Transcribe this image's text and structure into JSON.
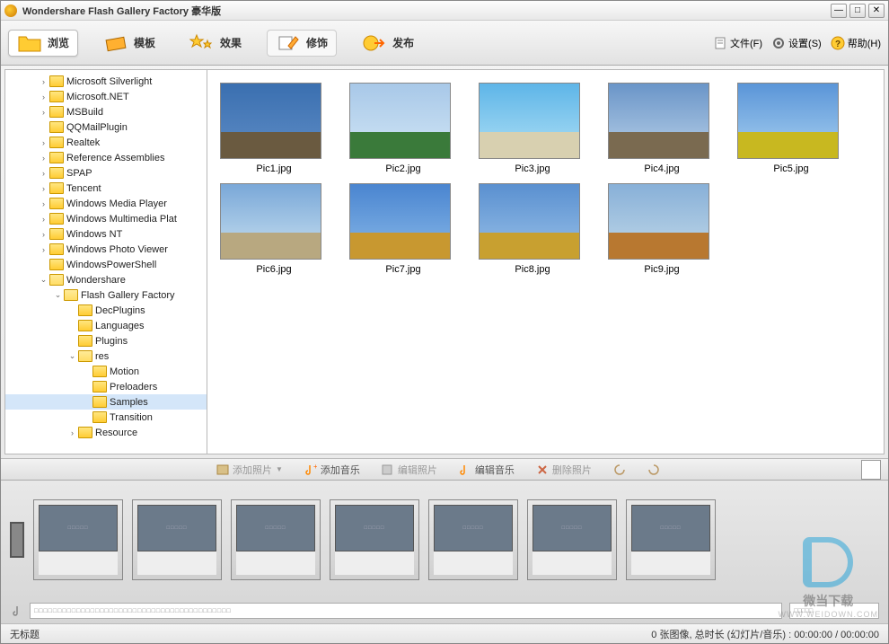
{
  "title": "Wondershare Flash Gallery Factory 豪华版",
  "toolbar": {
    "browse": "浏览",
    "template": "模板",
    "effect": "效果",
    "decorate": "修饰",
    "publish": "发布"
  },
  "menus": {
    "file": "文件(F)",
    "settings": "设置(S)",
    "help": "帮助(H)"
  },
  "tree": [
    {
      "level": 2,
      "arrow": "›",
      "label": "Microsoft Silverlight"
    },
    {
      "level": 2,
      "arrow": "›",
      "label": "Microsoft.NET"
    },
    {
      "level": 2,
      "arrow": "›",
      "label": "MSBuild"
    },
    {
      "level": 2,
      "arrow": "",
      "label": "QQMailPlugin"
    },
    {
      "level": 2,
      "arrow": "›",
      "label": "Realtek"
    },
    {
      "level": 2,
      "arrow": "›",
      "label": "Reference Assemblies"
    },
    {
      "level": 2,
      "arrow": "›",
      "label": "SPAP"
    },
    {
      "level": 2,
      "arrow": "›",
      "label": "Tencent"
    },
    {
      "level": 2,
      "arrow": "›",
      "label": "Windows Media Player"
    },
    {
      "level": 2,
      "arrow": "›",
      "label": "Windows Multimedia Plat"
    },
    {
      "level": 2,
      "arrow": "›",
      "label": "Windows NT"
    },
    {
      "level": 2,
      "arrow": "›",
      "label": "Windows Photo Viewer"
    },
    {
      "level": 2,
      "arrow": "",
      "label": "WindowsPowerShell"
    },
    {
      "level": 2,
      "arrow": "⌄",
      "label": "Wondershare",
      "open": true
    },
    {
      "level": 3,
      "arrow": "⌄",
      "label": "Flash Gallery Factory",
      "open": true
    },
    {
      "level": 4,
      "arrow": "",
      "label": "DecPlugins"
    },
    {
      "level": 4,
      "arrow": "",
      "label": "Languages"
    },
    {
      "level": 4,
      "arrow": "",
      "label": "Plugins"
    },
    {
      "level": 4,
      "arrow": "⌄",
      "label": "res",
      "open": true
    },
    {
      "level": 5,
      "arrow": "",
      "label": "Motion"
    },
    {
      "level": 5,
      "arrow": "",
      "label": "Preloaders"
    },
    {
      "level": 5,
      "arrow": "",
      "label": "Samples",
      "selected": true
    },
    {
      "level": 5,
      "arrow": "",
      "label": "Transition"
    },
    {
      "level": 4,
      "arrow": "›",
      "label": "Resource"
    }
  ],
  "thumbs": [
    {
      "label": "Pic1.jpg",
      "bg": "linear-gradient(#3a6fb0,#5e8cc5)",
      "ground": "#6a5a40"
    },
    {
      "label": "Pic2.jpg",
      "bg": "linear-gradient(#a8c8e8,#d0e5f5)",
      "ground": "#3a7a3a"
    },
    {
      "label": "Pic3.jpg",
      "bg": "linear-gradient(#5eb5e8,#afe0f5)",
      "ground": "#d8d0b0"
    },
    {
      "label": "Pic4.jpg",
      "bg": "linear-gradient(#6a95c8,#b8d0e8)",
      "ground": "#7a6a50"
    },
    {
      "label": "Pic5.jpg",
      "bg": "linear-gradient(#5a95d8,#a8d0f0)",
      "ground": "#c8b820"
    },
    {
      "label": "Pic6.jpg",
      "bg": "linear-gradient(#7aa8d8,#c8e0f0)",
      "ground": "#b8a880"
    },
    {
      "label": "Pic7.jpg",
      "bg": "linear-gradient(#4a85d0,#88b8e8)",
      "ground": "#c89830"
    },
    {
      "label": "Pic8.jpg",
      "bg": "linear-gradient(#5a90d0,#98c0e8)",
      "ground": "#c8a030"
    },
    {
      "label": "Pic9.jpg",
      "bg": "linear-gradient(#88b0d8,#c0d8e8)",
      "ground": "#b87830"
    }
  ],
  "actions": {
    "addPhoto": "添加照片",
    "addMusic": "添加音乐",
    "editPhoto": "编辑照片",
    "editMusic": "编辑音乐",
    "deletePhoto": "删除照片"
  },
  "status": {
    "left": "无标题",
    "right": "0 张图像, 总时长 (幻灯片/音乐) : 00:00:00 / 00:00:00"
  },
  "watermark": {
    "text": "微当下载",
    "url": "WWW.WEIDOWN.COM"
  },
  "placeholders": {
    "dots": "□□□□□",
    "audioDots": "□□□□□□□□□□□□□□□□□□□□□□□□□□□□□□□□□□□□□□□□□□",
    "audioDots2": "□□□□□"
  }
}
